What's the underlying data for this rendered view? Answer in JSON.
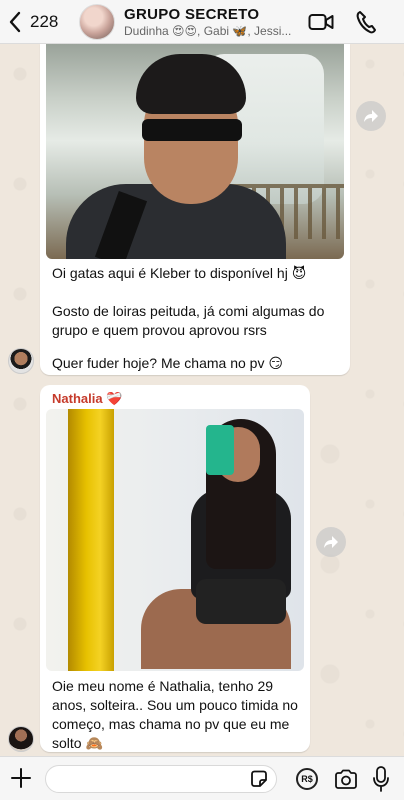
{
  "header": {
    "back_count": "228",
    "title": "GRUPO SECRETO",
    "members": "Dudinha 😍😍, Gabi 🦋, Jessi..."
  },
  "messages": [
    {
      "sender": "",
      "text_lines": [
        "Oi gatas aqui é Kleber to disponível hj 😈",
        "Gosto de loiras peituda, já comi algumas do grupo e quem provou aprovou rsrs",
        "Quer fuder hoje? Me chama no pv 😏"
      ]
    },
    {
      "sender": "Nathalia",
      "sender_emoji": "❤️‍🩹",
      "text": "Oie meu nome é Nathalia, tenho 29 anos, solteira.. Sou um pouco timida no começo, mas chama no pv que eu me solto 🙈"
    }
  ],
  "input": {
    "placeholder": ""
  },
  "icons": {
    "back": "chevron-left-icon",
    "video": "video-camera-icon",
    "call": "phone-icon",
    "forward": "forward-icon",
    "plus": "plus-icon",
    "sticker": "sticker-icon",
    "pay": "payment-icon",
    "camera": "camera-icon",
    "mic": "microphone-icon"
  },
  "pay_label": "R$",
  "colors": {
    "header_bg": "#f6f6f6",
    "chat_bg": "#efe7dd",
    "bubble_bg": "#ffffff",
    "sender_name": "#c63b2b"
  }
}
